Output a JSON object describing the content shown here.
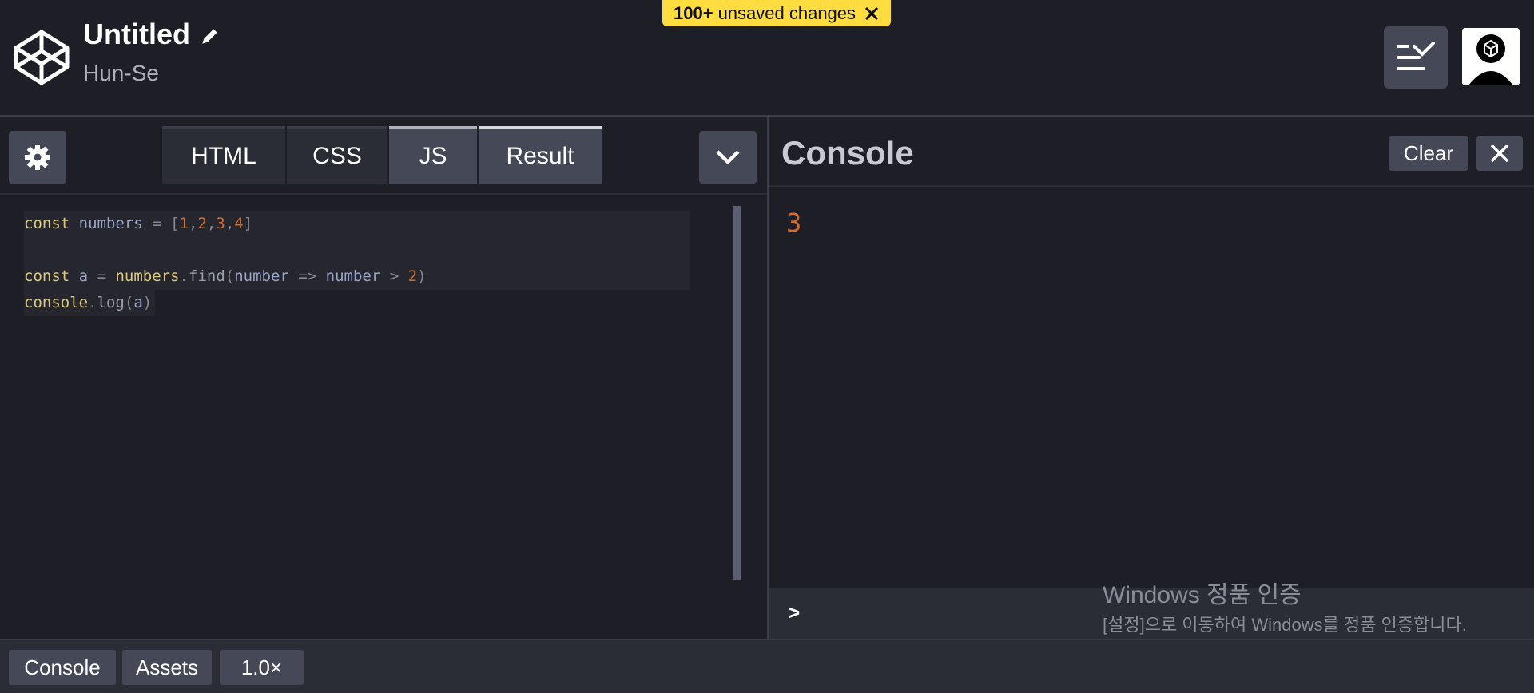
{
  "header": {
    "title": "Untitled",
    "author": "Hun-Se",
    "unsaved": {
      "count": "100+",
      "text": "unsaved changes"
    }
  },
  "editor": {
    "tabs": [
      {
        "label": "HTML"
      },
      {
        "label": "CSS"
      },
      {
        "label": "JS"
      },
      {
        "label": "Result"
      }
    ],
    "code": {
      "line1": {
        "kw": "const",
        "var": "numbers",
        "eq": "=",
        "lb": "[",
        "n1": "1",
        "n2": "2",
        "n3": "3",
        "n4": "4",
        "rb": "]"
      },
      "line3": {
        "kw": "const",
        "var": "a",
        "eq": "=",
        "obj": "numbers",
        "dot": ".",
        "fn": "find",
        "lp": "(",
        "p1": "number",
        "arrow": "=>",
        "p2": "number",
        "gt": ">",
        "n": "2",
        "rp": ")"
      },
      "line4": {
        "obj": "console",
        "dot": ".",
        "fn": "log",
        "lp": "(",
        "arg": "a",
        "rp": ")"
      }
    }
  },
  "console": {
    "title": "Console",
    "clear_label": "Clear",
    "output": "3",
    "prompt": ">"
  },
  "watermark": {
    "title": "Windows 정품 인증",
    "subtitle": "[설정]으로 이동하여 Windows를 정품 인증합니다."
  },
  "footer": {
    "console_label": "Console",
    "assets_label": "Assets",
    "zoom_label": "1.0×"
  },
  "colors": {
    "accent_yellow": "#ffdd40",
    "bg": "#1e1f26",
    "button": "#444857"
  },
  "icons": [
    "codepen-logo-icon",
    "pencil-icon",
    "close-icon",
    "layout-icon",
    "avatar-icon",
    "gear-icon",
    "chevron-down-icon"
  ]
}
